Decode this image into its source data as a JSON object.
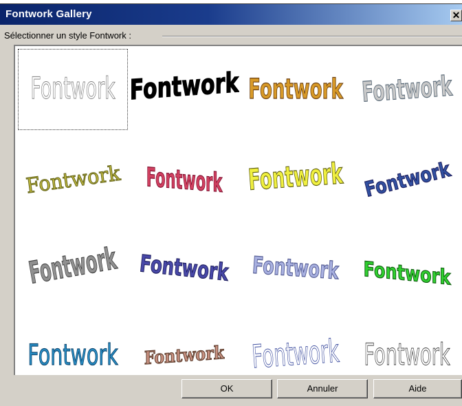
{
  "window": {
    "title": "Fontwork Gallery",
    "close_glyph": "✕"
  },
  "gallery": {
    "group_label": "Sélectionner un style Fontwork :",
    "sample_text": "Fontwork",
    "selected_index": 0,
    "styles": [
      {
        "name": "outline-condensed",
        "fill": "#ffffff",
        "stroke": "#808080"
      },
      {
        "name": "bold-black-arc",
        "fill": "#000000",
        "stroke": "#000000"
      },
      {
        "name": "gold-gradient-3d",
        "fill": "#d89a28",
        "stroke": "#6b3f10"
      },
      {
        "name": "silver-slant",
        "fill": "#c8c8c8",
        "stroke": "#5a6a78"
      },
      {
        "name": "olive-serif-tilt",
        "fill": "#c8c040",
        "stroke": "#6c6c20"
      },
      {
        "name": "pink-perspective",
        "fill": "#d04060",
        "stroke": "#801030"
      },
      {
        "name": "yellow-3d",
        "fill": "#f0f040",
        "stroke": "#606010"
      },
      {
        "name": "blue-rise",
        "fill": "#3050a0",
        "stroke": "#202060"
      },
      {
        "name": "grey-extrude",
        "fill": "#909090",
        "stroke": "#404040"
      },
      {
        "name": "navy-wave",
        "fill": "#4848a8",
        "stroke": "#202060"
      },
      {
        "name": "lavender-wave",
        "fill": "#a8b0e0",
        "stroke": "#505890"
      },
      {
        "name": "green-arch",
        "fill": "#30d030",
        "stroke": "#106010"
      },
      {
        "name": "teal-sans",
        "fill": "#2890c8",
        "stroke": "#104870"
      },
      {
        "name": "brown-arc",
        "fill": "#c89080",
        "stroke": "#604030"
      },
      {
        "name": "blue-outline-slant",
        "fill": "#ffffff",
        "stroke": "#4050a0"
      },
      {
        "name": "plain-outline",
        "fill": "#ffffff",
        "stroke": "#404040"
      }
    ]
  },
  "buttons": {
    "ok": "OK",
    "cancel": "Annuler",
    "help": "Aide"
  }
}
